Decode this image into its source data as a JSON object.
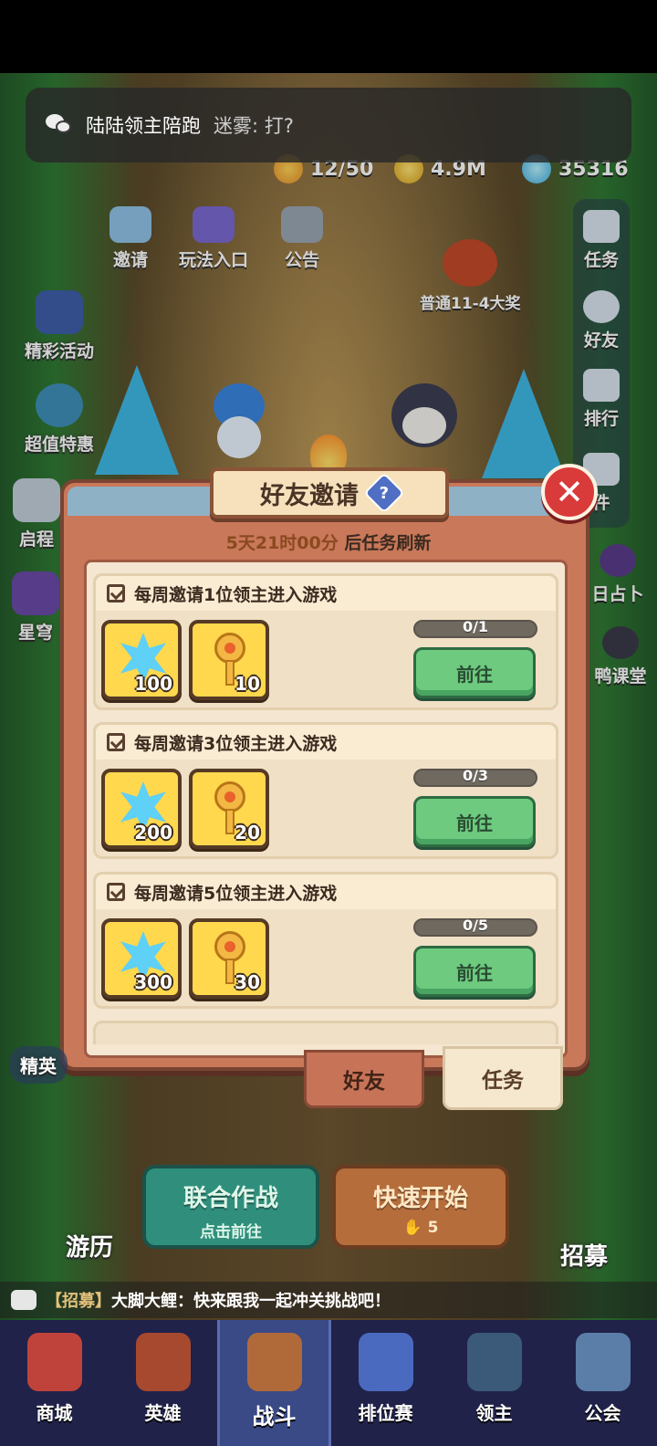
{
  "notification": {
    "sender": "陆陆领主陪跑",
    "message": "迷雾: 打?"
  },
  "resources": {
    "energy": "12/50",
    "gold": "4.9M",
    "gems": "35316"
  },
  "left_menu": {
    "items": [
      "精彩活动",
      "超值特惠",
      "启程",
      "星穹"
    ]
  },
  "top_menu": {
    "items": [
      "邀请",
      "玩法入口",
      "公告"
    ],
    "reward_label": "普通11-4大奖"
  },
  "right_menu": {
    "items": [
      "任务",
      "好友",
      "排行",
      "件",
      "日占卜",
      "鸭课堂"
    ]
  },
  "dialog": {
    "title": "好友邀请",
    "help_symbol": "?",
    "close_symbol": "✕",
    "refresh_time": "5天21时00分",
    "refresh_suffix": " 后任务刷新",
    "tasks": [
      {
        "title": "每周邀请1位领主进入游戏",
        "rewards": [
          {
            "icon": "snowflake-gem",
            "qty": "100"
          },
          {
            "icon": "key",
            "qty": "10"
          }
        ],
        "progress_text": "0/1",
        "progress": 0,
        "button": "前往"
      },
      {
        "title": "每周邀请3位领主进入游戏",
        "rewards": [
          {
            "icon": "snowflake-gem",
            "qty": "200"
          },
          {
            "icon": "key",
            "qty": "20"
          }
        ],
        "progress_text": "0/3",
        "progress": 0,
        "button": "前往"
      },
      {
        "title": "每周邀请5位领主进入游戏",
        "rewards": [
          {
            "icon": "snowflake-gem",
            "qty": "300"
          },
          {
            "icon": "key",
            "qty": "30"
          }
        ],
        "progress_text": "0/5",
        "progress": 0,
        "button": "前往"
      }
    ],
    "tabs": [
      "好友",
      "任务"
    ],
    "active_tab": "任务"
  },
  "scene": {
    "travel_label": "游历",
    "recruit_label": "招募",
    "elite_label": "精英"
  },
  "buttons": {
    "coop_title": "联合作战",
    "coop_sub": "点击前往",
    "quick_title": "快速开始",
    "quick_cost": "5"
  },
  "chat": {
    "tag": "【招募】",
    "text": "大脚大鲤：快来跟我一起冲关挑战吧！"
  },
  "bottom_nav": {
    "items": [
      "商城",
      "英雄",
      "战斗",
      "排位赛",
      "领主",
      "公会"
    ],
    "active": "战斗"
  },
  "colors": {
    "go_button": "#6dca7f",
    "close_button": "#d93a3a",
    "dialog_frame": "#c9785a",
    "nav_bg": "#20224a"
  }
}
